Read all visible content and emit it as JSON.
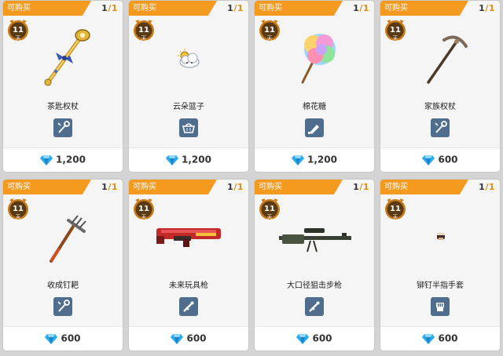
{
  "badge_label": "可购买",
  "duration_days": "11",
  "duration_unit": "天",
  "colors": {
    "banner": "#f39a1f",
    "category_icon_bg": "#4f6d8c",
    "gem": "#29a9f0"
  },
  "items": [
    {
      "name": "茶匙权杖",
      "purchasable": "1",
      "limit": "1",
      "price": "1,200",
      "category_icon": "scepter-icon",
      "image": "golden-scepter"
    },
    {
      "name": "云朵篮子",
      "purchasable": "1",
      "limit": "1",
      "price": "1,200",
      "category_icon": "basket-icon",
      "image": "cloud-basket"
    },
    {
      "name": "棉花糖",
      "purchasable": "1",
      "limit": "1",
      "price": "1,200",
      "category_icon": "bat-icon",
      "image": "cotton-candy"
    },
    {
      "name": "家族权杖",
      "purchasable": "1",
      "limit": "1",
      "price": "600",
      "category_icon": "scepter-icon",
      "image": "pickaxe-scepter"
    },
    {
      "name": "收成钉耙",
      "purchasable": "1",
      "limit": "1",
      "price": "600",
      "category_icon": "scepter-icon",
      "image": "rake"
    },
    {
      "name": "未来玩具枪",
      "purchasable": "1",
      "limit": "1",
      "price": "600",
      "category_icon": "gun-icon",
      "image": "toy-gun"
    },
    {
      "name": "大口径狙击步枪",
      "purchasable": "1",
      "limit": "1",
      "price": "600",
      "category_icon": "gun-icon",
      "image": "sniper-rifle"
    },
    {
      "name": "铆钉半指手套",
      "purchasable": "1",
      "limit": "1",
      "price": "600",
      "category_icon": "glove-icon",
      "image": "studded-glove"
    }
  ]
}
